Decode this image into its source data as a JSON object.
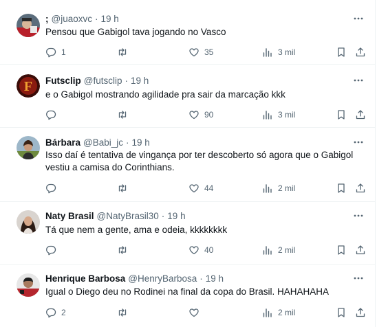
{
  "tweets": [
    {
      "name": ";",
      "handle": "@juaoxvc",
      "separator": "·",
      "time": "19 h",
      "text": [
        "Pensou que Gabigol tava jogando no Vasco"
      ],
      "replies": "1",
      "retweets": "",
      "likes": "35",
      "views": "3 mil"
    },
    {
      "name": "Futsclip",
      "handle": "@futsclip",
      "separator": "·",
      "time": "19 h",
      "text": [
        "e o Gabigol mostrando agilidade pra sair da marcação kkk"
      ],
      "replies": "",
      "retweets": "",
      "likes": "90",
      "views": "3 mil"
    },
    {
      "name": "Bárbara",
      "handle": "@Babi_jc",
      "separator": "·",
      "time": "19 h",
      "text": [
        "Isso daí é tentativa de vingança por ter descoberto só agora que o Gabigol",
        "vestiu a camisa do Corinthians."
      ],
      "replies": "",
      "retweets": "",
      "likes": "44",
      "views": "2 mil"
    },
    {
      "name": "Naty Brasil",
      "handle": "@NatyBrasil30",
      "separator": "·",
      "time": "19 h",
      "text": [
        "Tá que nem a gente, ama e odeia, kkkkkkkk"
      ],
      "replies": "",
      "retweets": "",
      "likes": "40",
      "views": "2 mil"
    },
    {
      "name": "Henrique Barbosa",
      "handle": "@HenryBarbosa",
      "separator": "·",
      "time": "19 h",
      "text": [
        "Igual o Diego deu no Rodinei na final da copa do Brasil. HAHAHAHA"
      ],
      "replies": "2",
      "retweets": "",
      "likes": "",
      "views": "2 mil"
    }
  ],
  "icons": {
    "reply": "reply-icon",
    "retweet": "retweet-icon",
    "like": "heart-icon",
    "views": "views-chart-icon",
    "bookmark": "bookmark-icon",
    "share": "share-icon",
    "more": "more-options-icon"
  },
  "colors": {
    "text_primary": "#0f1419",
    "text_secondary": "#536471",
    "divider": "#eff3f4"
  }
}
